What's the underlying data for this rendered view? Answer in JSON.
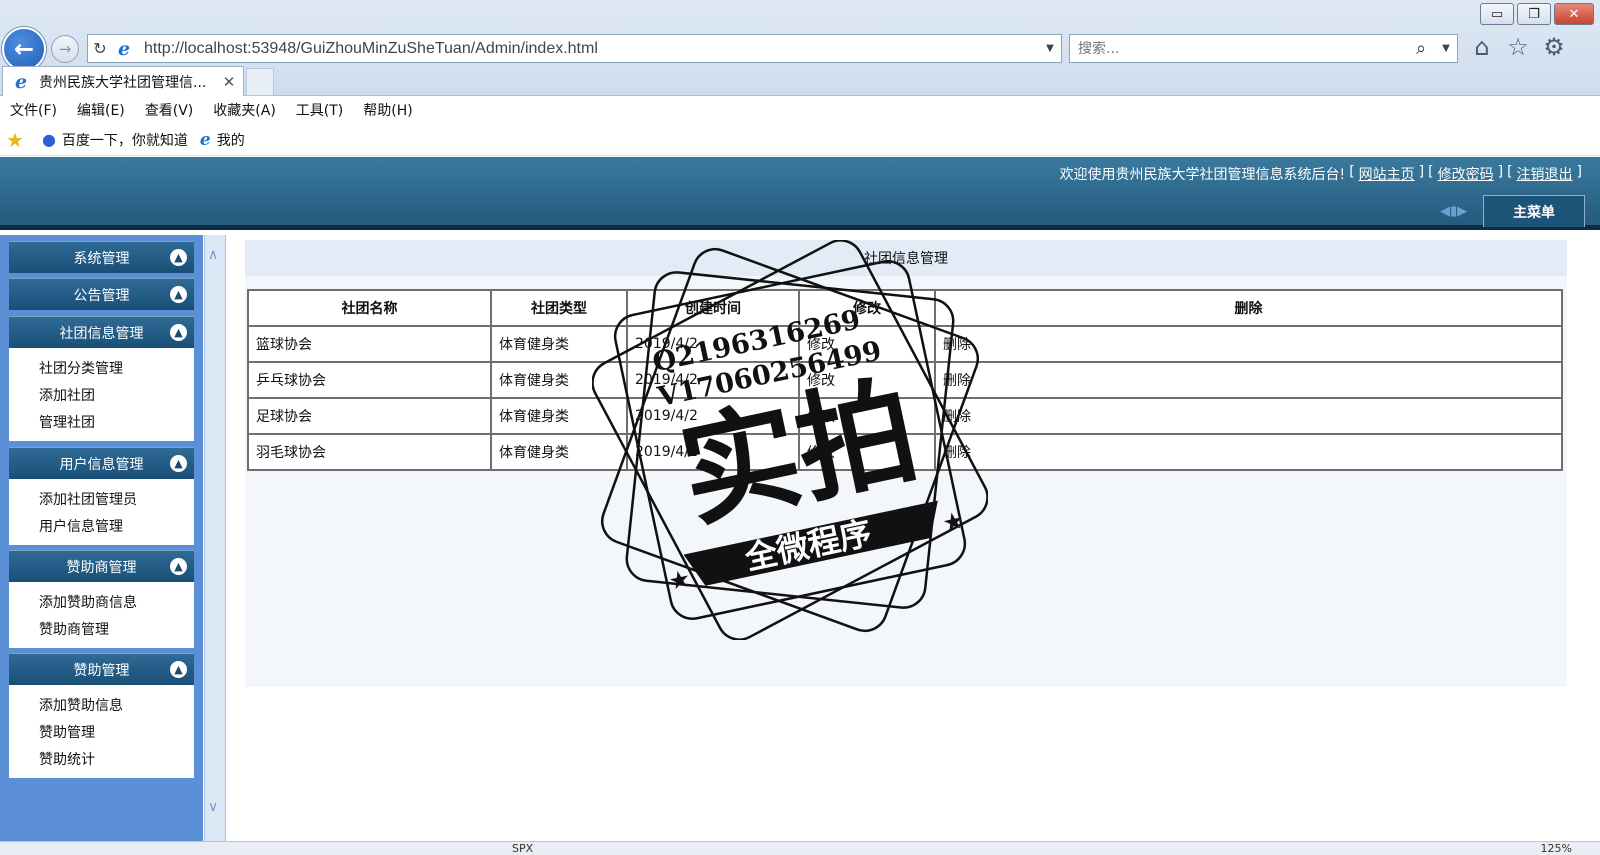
{
  "browser": {
    "url": "http://localhost:53948/GuiZhouMinZuSheTuan/Admin/index.html",
    "search_placeholder": "搜索...",
    "tab_title": "贵州民族大学社团管理信...",
    "window_buttons": {
      "minimize": "▭",
      "restore": "❐",
      "close": "✕"
    },
    "icons": [
      "home-icon",
      "favorites-star-icon",
      "settings-gear-icon"
    ],
    "menu": [
      "文件(F)",
      "编辑(E)",
      "查看(V)",
      "收藏夹(A)",
      "工具(T)",
      "帮助(H)"
    ],
    "favorites": [
      "百度一下，你就知道",
      "我的"
    ],
    "status_text": "SPX",
    "zoom": "125%"
  },
  "header": {
    "welcome": "欢迎使用贵州民族大学社团管理信息系统后台!",
    "links": [
      "网站主页",
      "修改密码",
      "注销退出"
    ],
    "main_menu": "主菜单"
  },
  "sidebar": [
    {
      "title": "系统管理",
      "items": []
    },
    {
      "title": "公告管理",
      "items": []
    },
    {
      "title": "社团信息管理",
      "items": [
        "社团分类管理",
        "添加社团",
        "管理社团"
      ]
    },
    {
      "title": "用户信息管理",
      "items": [
        "添加社团管理员",
        "用户信息管理"
      ]
    },
    {
      "title": "赞助商管理",
      "items": [
        "添加赞助商信息",
        "赞助商管理"
      ]
    },
    {
      "title": "赞助管理",
      "items": [
        "添加赞助信息",
        "赞助管理",
        "赞助统计"
      ]
    }
  ],
  "main": {
    "title": "社团信息管理",
    "columns": [
      "社团名称",
      "社团类型",
      "创建时间",
      "修改",
      "删除"
    ],
    "rows": [
      {
        "name": "篮球协会",
        "type": "体育健身类",
        "created": "2019/4/2",
        "edit": "修改",
        "delete": "删除"
      },
      {
        "name": "乒乓球协会",
        "type": "体育健身类",
        "created": "2019/4/2",
        "edit": "修改",
        "delete": "删除"
      },
      {
        "name": "足球协会",
        "type": "体育健身类",
        "created": "2019/4/2",
        "edit": "修改",
        "delete": "删除"
      },
      {
        "name": "羽毛球协会",
        "type": "体育健身类",
        "created": "2019/4/2",
        "edit": "修改",
        "delete": "删除"
      }
    ]
  },
  "watermark": {
    "line1": "Q2196316269",
    "line2": "V17060256499",
    "big": "实拍",
    "banner": "全微程序"
  }
}
